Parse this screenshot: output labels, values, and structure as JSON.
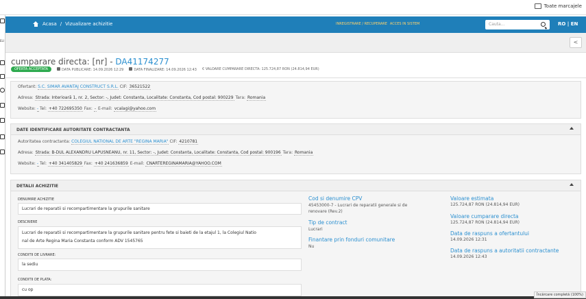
{
  "bookmarks": {
    "right_label": "Toate marcajele"
  },
  "rail": {
    "bottom_text": "ELI"
  },
  "nav": {
    "breadcrumb_home": "Acasa",
    "breadcrumb_sep": "/",
    "breadcrumb_current": "Vizualizare achizitie",
    "register": "INREGISTRARE / RECUPERARE",
    "login": "ACCES IN SISTEM",
    "search_placeholder": "Cauta...",
    "lang": "RO | EN"
  },
  "subbar": {
    "back": "<"
  },
  "header": {
    "title_prefix": "cumparare directa: [nr] - ",
    "code": "DA41174277",
    "badge": "OFERTA ACCEPTATA",
    "pub": "DATA PUBLICARE: 14.09.2026 12:29",
    "fin": "DATA FINALIZARE: 14.09.2026 12:43",
    "val": "€ VALOARE CUMPARARE DIRECTA: 125.724,87  RON (24.814,94  EUR)"
  },
  "ofertant": {
    "ofertant_lbl": "Ofertant:",
    "ofertant_val": "S.C. SIMAR AVANTAJ CONSTRUCT S.R.L.",
    "cif_lbl": "CIF:",
    "cif_val": "36521522",
    "adresa_lbl": "Adresa:",
    "adresa_val": "Strada: Interioară 1, nr. 2, Sector: -, Judet: Constanta, Localitate: Constanta, Cod postal: 900229",
    "tara_lbl": "Tara:",
    "tara_val": "Romania",
    "web_lbl": "Website:",
    "web_val": "-",
    "tel_lbl": "Tel:",
    "tel_val": "+40 722695350",
    "fax_lbl": "Fax:",
    "fax_val": "-",
    "email_lbl": "E-mail:",
    "email_val": "vcalagi@yahoo.com"
  },
  "autoritate": {
    "heading": "DATE IDENTIFICARE AUTORITATE CONTRACTANTA",
    "lbl": "Autoritatea contractanta:",
    "val": "COLEGIUL NATIONAL DE ARTE \"REGINA MARIA\"",
    "cif_lbl": "CIF:",
    "cif_val": "4210781",
    "adresa_lbl": "Adresa:",
    "adresa_val": "Strada: B-DUL ALEXANDRU LAPUSNEANU, nr. 11, Sector: -, Judet: Constanta, Localitate: Constanta, Cod postal: 900196",
    "tara_lbl": "Tara:",
    "tara_val": "Romania",
    "web_lbl": "Website:",
    "web_val": "-",
    "tel_lbl": "Tel:",
    "tel_val": "+40 341405829",
    "fax_lbl": "Fax:",
    "fax_val": "+40 241636859",
    "email_lbl": "E-mail:",
    "email_val": "CNARTEREGINAMARIA@YAHOO.COM"
  },
  "achizitie": {
    "heading": "DETALII ACHIZITIE",
    "denumire_lbl": "DENUMIRE ACHIZITIE",
    "denumire_val": "Lucrari de reparatii si recompartimentare la grupurile sanitare",
    "descriere_lbl": "DESCRIERE",
    "descriere_line1": "Lucrari de reparatii si recompartimentare la grupurile sanitare pentru fete si baieti de la etajul 1, la Colegiul Natio",
    "descriere_line2": "nal de Arte Regina Maria Constanta conform ADV 1545765",
    "livrare_lbl": "CONDITII DE LIVRARE:",
    "livrare_val": "la sediu",
    "plata_lbl": "CONDITII DE PLATA:",
    "plata_val": "cu op",
    "cpv_lbl": "Cod si denumire CPV",
    "cpv_val1": "45453000-7 - Lucrari de reparatii generale si de",
    "cpv_val2": "renovare (Rev.2)",
    "tip_lbl": "Tip de contract",
    "tip_val": "Lucrari",
    "fond_lbl": "Finantare prin fonduri comunitare",
    "fond_val": "Nu",
    "est_lbl": "Valoare estimata",
    "est_val": "125.724,87  RON (24.814,94  EUR)",
    "cump_lbl": "Valoare cumparare directa",
    "cump_val": "125.724,87  RON (24.814,94  EUR)",
    "rasp_lbl": "Data de raspuns a ofertantului",
    "rasp_val": "14.09.2026 12:31",
    "rasp2_lbl": "Data de raspuns a autoritatii contractante",
    "rasp2_val": "14.09.2026 12:43"
  },
  "status": "Încărcare completă (100%)"
}
